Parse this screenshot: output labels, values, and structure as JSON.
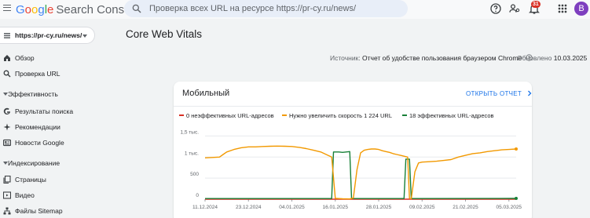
{
  "header": {
    "logo_google": [
      "G",
      "o",
      "o",
      "g",
      "l",
      "e"
    ],
    "logo_product": "Search Console",
    "search_placeholder": "Проверка всех URL на ресурсе https://pr-cy.ru/news/",
    "notifications_count": "31",
    "avatar_letter": "B"
  },
  "sidebar": {
    "property": "https://pr-cy.ru/news/",
    "items": [
      {
        "label": "Обзор",
        "icon": "home-icon"
      },
      {
        "label": "Проверка URL",
        "icon": "search-icon"
      }
    ],
    "sections": [
      {
        "label": "Эффективность",
        "items": [
          {
            "label": "Результаты поиска",
            "icon": "google-g-icon"
          },
          {
            "label": "Рекомендации",
            "icon": "sparkle-icon"
          },
          {
            "label": "Новости Google",
            "icon": "news-icon"
          }
        ]
      },
      {
        "label": "Индексирование",
        "items": [
          {
            "label": "Страницы",
            "icon": "pages-icon"
          },
          {
            "label": "Видео",
            "icon": "video-icon"
          },
          {
            "label": "Файлы Sitemap",
            "icon": "sitemap-icon"
          }
        ]
      }
    ]
  },
  "main": {
    "title": "Core Web Vitals",
    "source_prefix": "Источник:",
    "source_value": "Отчет об удобстве пользования браузером Chrome",
    "updated_prefix": "Обновлено",
    "updated_value": "10.03.2025"
  },
  "card": {
    "title": "Мобильный",
    "report_link": "ОТКРЫТЬ ОТЧЕТ",
    "legend": [
      {
        "label": "0 неэффективных URL-адресов",
        "color": "#d93025"
      },
      {
        "label": "Нужно увеличить скорость 1 224 URL",
        "color": "#f29900"
      },
      {
        "label": "18 эффективных URL-адресов",
        "color": "#188038"
      }
    ]
  },
  "chart_data": {
    "type": "line",
    "ytick_labels": [
      "1,5 тыс.",
      "1 тыс.",
      "500",
      "0"
    ],
    "ytick_values": [
      1500,
      1000,
      500,
      0
    ],
    "ylim": [
      0,
      1600
    ],
    "xlim": [
      0,
      86
    ],
    "x_tick_labels": [
      "11.12.2024",
      "23.12.2024",
      "04.01.2025",
      "16.01.2025",
      "28.01.2025",
      "09.02.2025",
      "21.02.2025",
      "05.03.2025"
    ],
    "x_tick_day_index": [
      0,
      12,
      24,
      36,
      48,
      60,
      72,
      84
    ],
    "grid": true,
    "series": [
      {
        "name": "Нужно увеличить скорость",
        "color": "#f29900",
        "points": [
          [
            0,
            980
          ],
          [
            2,
            990
          ],
          [
            4,
            1000
          ],
          [
            5,
            1060
          ],
          [
            6,
            1120
          ],
          [
            8,
            1180
          ],
          [
            10,
            1220
          ],
          [
            12,
            1240
          ],
          [
            14,
            1240
          ],
          [
            16,
            1250
          ],
          [
            18,
            1255
          ],
          [
            20,
            1260
          ],
          [
            22,
            1255
          ],
          [
            24,
            1250
          ],
          [
            26,
            1230
          ],
          [
            28,
            1200
          ],
          [
            30,
            1160
          ],
          [
            32,
            1120
          ],
          [
            34,
            1040
          ],
          [
            35,
            1000
          ],
          [
            36,
            20
          ],
          [
            38,
            10
          ],
          [
            40,
            5
          ],
          [
            41,
            30
          ],
          [
            42,
            700
          ],
          [
            43,
            1100
          ],
          [
            44,
            1160
          ],
          [
            45,
            1180
          ],
          [
            46,
            1190
          ],
          [
            47,
            1190
          ],
          [
            48,
            1180
          ],
          [
            49,
            1150
          ],
          [
            50,
            1130
          ],
          [
            51,
            1110
          ],
          [
            52,
            1080
          ],
          [
            53,
            1060
          ],
          [
            54,
            1040
          ],
          [
            55,
            1020
          ],
          [
            56,
            1000
          ],
          [
            56.5,
            20
          ],
          [
            57,
            10
          ],
          [
            58,
            650
          ],
          [
            59,
            860
          ],
          [
            60,
            880
          ],
          [
            62,
            890
          ],
          [
            64,
            900
          ],
          [
            66,
            920
          ],
          [
            68,
            940
          ],
          [
            70,
            1000
          ],
          [
            72,
            1040
          ],
          [
            74,
            1080
          ],
          [
            76,
            1100
          ],
          [
            78,
            1130
          ],
          [
            80,
            1150
          ],
          [
            82,
            1170
          ],
          [
            84,
            1180
          ],
          [
            86,
            1190
          ]
        ]
      },
      {
        "name": "Эффективные",
        "color": "#188038",
        "points": [
          [
            0,
            15
          ],
          [
            35,
            15
          ],
          [
            35.5,
            1120
          ],
          [
            37,
            1120
          ],
          [
            38,
            1110
          ],
          [
            39,
            1120
          ],
          [
            40,
            1130
          ],
          [
            40.5,
            15
          ],
          [
            41,
            15
          ],
          [
            55,
            15
          ],
          [
            55.5,
            950
          ],
          [
            56.5,
            950
          ],
          [
            57,
            15
          ],
          [
            86,
            18
          ]
        ]
      },
      {
        "name": "Неэффективные",
        "color": "#d93025",
        "points": [
          [
            0,
            0
          ],
          [
            86,
            0
          ]
        ]
      }
    ]
  }
}
